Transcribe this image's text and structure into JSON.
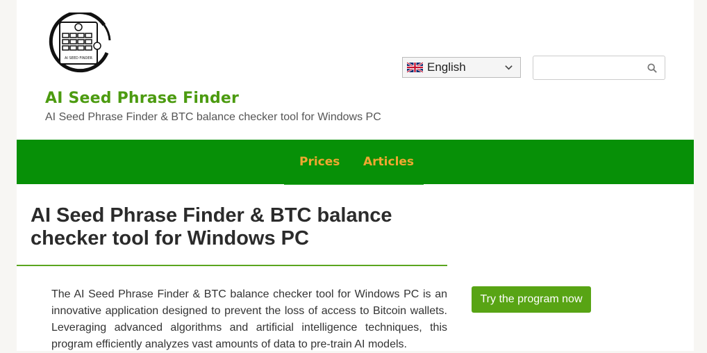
{
  "header": {
    "logo_text": "AI SEED FINDER",
    "site_title": "AI Seed Phrase Finder",
    "tagline": "AI Seed Phrase Finder & BTC balance checker tool for Windows PC"
  },
  "language": {
    "selected": "English",
    "flag_icon": "uk-flag-icon"
  },
  "search": {
    "value": "",
    "icon": "search-icon"
  },
  "nav": {
    "items": [
      {
        "label": "Prices"
      },
      {
        "label": "Articles"
      }
    ]
  },
  "main": {
    "title": "AI Seed Phrase Finder & BTC balance checker tool for Windows PC",
    "intro": "The AI Seed Phrase Finder & BTC balance checker tool for Windows PC is an innovative application designed to prevent the loss of access to Bitcoin wallets. Leveraging advanced algorithms and artificial intelligence techniques, this program efficiently analyzes vast amounts of data to pre-train AI models."
  },
  "sidebar": {
    "cta_label": "Try the program now"
  },
  "colors": {
    "nav_bg": "#079007",
    "nav_link": "#f0a830",
    "brand_green": "#4c9b10",
    "cta_bg": "#58a414"
  }
}
